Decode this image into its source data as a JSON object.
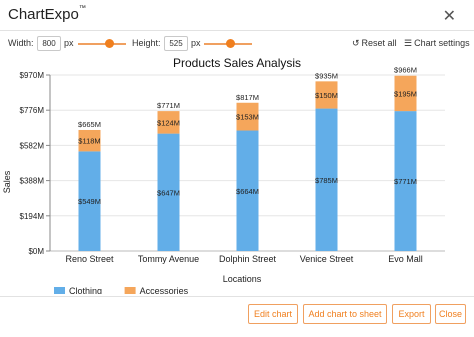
{
  "window": {
    "title": "ChartExpo",
    "trademark": "™"
  },
  "toolbar": {
    "width_label": "Width:",
    "width_value": "800",
    "width_unit": "px",
    "width_slider_fraction": 0.65,
    "height_label": "Height:",
    "height_value": "525",
    "height_unit": "px",
    "height_slider_fraction": 0.55,
    "reset_label": "Reset all",
    "settings_label": "Chart settings"
  },
  "chart_data": {
    "type": "bar",
    "stacked": true,
    "title": "Products Sales Analysis",
    "xlabel": "Locations",
    "ylabel": "Sales",
    "categories": [
      "Reno Street",
      "Tommy Avenue",
      "Dolphin Street",
      "Venice Street",
      "Evo Mall"
    ],
    "series": [
      {
        "name": "Clothing",
        "color": "#62aee8",
        "values": [
          549,
          647,
          664,
          785,
          771
        ],
        "labels": [
          "$549M",
          "$647M",
          "$664M",
          "$785M",
          "$771M"
        ]
      },
      {
        "name": "Accessories",
        "color": "#f5a65b",
        "values": [
          118,
          124,
          153,
          150,
          195
        ],
        "labels": [
          "$118M",
          "$124M",
          "$153M",
          "$150M",
          "$195M"
        ]
      }
    ],
    "totals": [
      "$665M",
      "$771M",
      "$817M",
      "$935M",
      "$966M"
    ],
    "yticks": [
      "$0M",
      "$194M",
      "$388M",
      "$582M",
      "$776M",
      "$970M"
    ],
    "ylim": [
      0,
      970
    ],
    "legend_position": "bottom-left"
  },
  "footer": {
    "edit": "Edit chart",
    "add": "Add chart to sheet",
    "export": "Export",
    "close": "Close"
  }
}
